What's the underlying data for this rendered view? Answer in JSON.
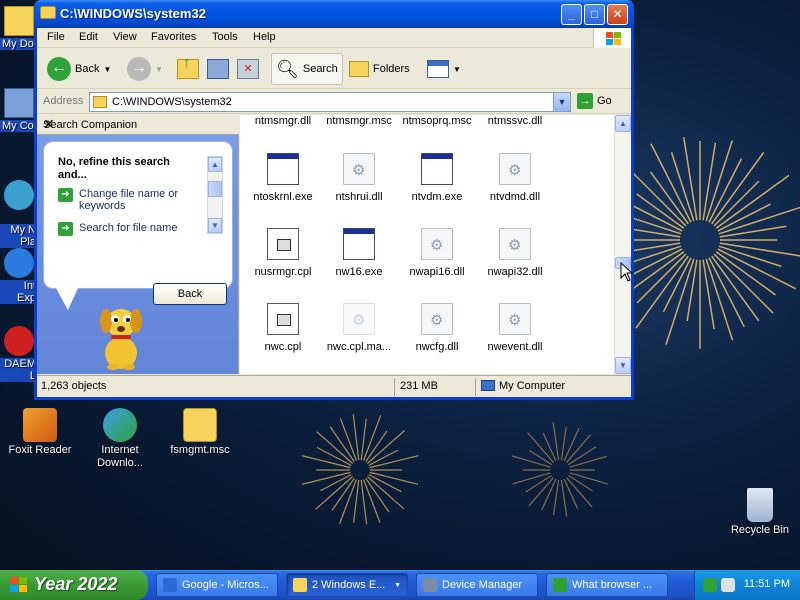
{
  "desktop": {
    "left_stubs": [
      "My Do",
      "My Co",
      "My N\nPla",
      "Int\nExp",
      "DAEM\nL"
    ],
    "icons": [
      {
        "label": "Foxit Reader"
      },
      {
        "label": "Internet Downlo..."
      },
      {
        "label": "fsmgmt.msc"
      },
      {
        "label": "Recycle Bin"
      }
    ]
  },
  "window": {
    "title": "C:\\WINDOWS\\system32",
    "buttons": {
      "minimize": "_",
      "maximize": "□",
      "close": "✕"
    },
    "menu": [
      "File",
      "Edit",
      "View",
      "Favorites",
      "Tools",
      "Help"
    ],
    "toolbar": {
      "back": "Back",
      "search": "Search",
      "folders": "Folders"
    },
    "address": {
      "label": "Address",
      "value": "C:\\WINDOWS\\system32",
      "go": "Go"
    },
    "companion": {
      "header": "Search Companion",
      "close": "✕",
      "heading": "No, refine this search and...",
      "options": [
        "Change file name or keywords",
        "Search for file name"
      ],
      "back_button": "Back"
    },
    "files": {
      "top_row": [
        "ntmsmgr.dll",
        "ntmsmgr.msc",
        "ntmsoprq.msc",
        "ntmssvc.dll"
      ],
      "rows": [
        [
          {
            "name": "ntoskrnl.exe",
            "icon": "exe"
          },
          {
            "name": "ntshrui.dll",
            "icon": "dll"
          },
          {
            "name": "ntvdm.exe",
            "icon": "exe"
          },
          {
            "name": "ntvdmd.dll",
            "icon": "dll"
          }
        ],
        [
          {
            "name": "nusrmgr.cpl",
            "icon": "cpl"
          },
          {
            "name": "nw16.exe",
            "icon": "exe"
          },
          {
            "name": "nwapi16.dll",
            "icon": "dll"
          },
          {
            "name": "nwapi32.dll",
            "icon": "dll"
          }
        ],
        [
          {
            "name": "nwc.cpl",
            "icon": "cpl"
          },
          {
            "name": "nwc.cpl.ma...",
            "icon": "dll-faded"
          },
          {
            "name": "nwcfg.dll",
            "icon": "dll"
          },
          {
            "name": "nwevent.dll",
            "icon": "dll"
          }
        ]
      ]
    },
    "status": {
      "objects": "1,263 objects",
      "size": "231 MB",
      "location": "My Computer"
    }
  },
  "taskbar": {
    "start": "Year 2022",
    "tasks": [
      {
        "label": "Google - Micros...",
        "color": "#2a6ad8",
        "active": false
      },
      {
        "label": "2 Windows E...",
        "color": "#f6d45c",
        "active": true
      },
      {
        "label": "Device Manager",
        "color": "#7a8aa8",
        "active": false
      },
      {
        "label": "What browser ...",
        "color": "#2f9e33",
        "active": false
      }
    ],
    "clock": "11:51 PM"
  }
}
